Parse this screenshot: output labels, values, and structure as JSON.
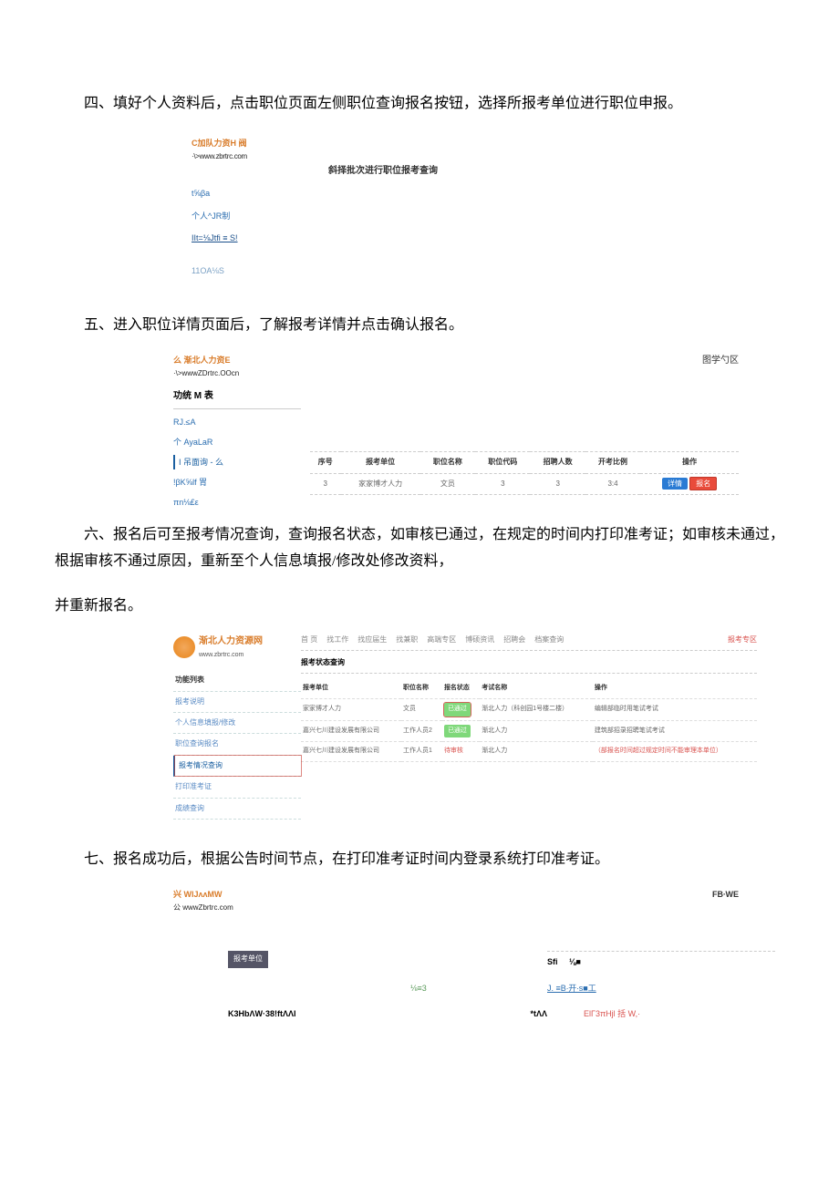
{
  "section4": {
    "instruction": "四、填好个人资料后，点击职位页面左侧职位查询报名按钮，选择所报考单位进行职位申报。",
    "logo": {
      "line1": "C加队力资H 阀",
      "line2": "·\\>www.zbrtrc.com"
    },
    "menu": {
      "item1": "t⅝βa",
      "item2": "个人^JR制",
      "item3": "IIt=⅛Jtfi ≡ S!",
      "item4": "11OA⅛S"
    },
    "main_title": "斜择批次进行职位报考查询"
  },
  "section5": {
    "instruction": "五、进入职位详情页面后，了解报考详情并点击确认报名。",
    "logo": {
      "line1": "么  渐北人力资E",
      "line2": "·\\>wwwZDrtrc.OOcn"
    },
    "sidebar_title": "功统 M 表",
    "menu": {
      "item1": "RJ.≤A",
      "item2": "个 AyaLaR",
      "item3": "I 吊面询 - 么",
      "item4": "!βK⅝lf 胃",
      "item5": "πn⅛£ε"
    },
    "right_top": "图学勺区",
    "table": {
      "headers": [
        "序号",
        "报考单位",
        "职位名称",
        "职位代码",
        "招聘人数",
        "开考比例",
        "操作"
      ],
      "row": [
        "3",
        "家家博才人力",
        "文员",
        "3",
        "3",
        "3:4"
      ],
      "btn_detail": "详情",
      "btn_apply": "报名"
    }
  },
  "section6": {
    "instruction_p1": "六、报名后可至报考情况查询，查询报名状态，如审核已通过，在规定的时间内打印准考证；如审核未通过，根据审核不通过原因，重新至个人信息填报/修改处修改资料，",
    "instruction_p2": "并重新报名。",
    "logo": {
      "line1": "渐北人力资源网",
      "line2": "www.zbrtrc.com"
    },
    "menu_title": "功能列表",
    "menu": {
      "item1": "报考说明",
      "item2": "个人信息填报/修改",
      "item3": "职位查询报名",
      "item4": "报考情况查询",
      "item5": "打印准考证",
      "item6": "成绩查询"
    },
    "tabs": [
      "首 页",
      "找工作",
      "找应届生",
      "找兼职",
      "高端专区",
      "博硕资讯",
      "招聘会",
      "档案查询",
      "报考专区"
    ],
    "subtitle": "报考状态查询",
    "headers": [
      "报考单位",
      "职位名称",
      "报名状态",
      "考试名称",
      "操作"
    ],
    "rows": [
      {
        "c1": "家家博才人力",
        "c2": "文员",
        "status_label": "已通过",
        "status_type": "green_boxed",
        "c4": "渐北人力（科创园1号楼二楼）",
        "c5": "编辑部临时用笔试考试"
      },
      {
        "c1": "嘉兴七川建设发展有限公司",
        "c2": "工作人员2",
        "status_label": "已通过",
        "status_type": "green",
        "c4": "渐北人力",
        "c5": "建筑部招录招聘笔试考试"
      },
      {
        "c1": "嘉兴七川建设发展有限公司",
        "c2": "工作人员1",
        "status_label": "待审核",
        "status_type": "red",
        "c4": "渐北人力",
        "c5": "（部报名时间超过规定时间不能审理本单位）"
      }
    ]
  },
  "section7": {
    "instruction": "七、报名成功后，根据公告时间节点，在打印准考证时间内登录系统打印准考证。",
    "logo": {
      "line1": "兴 WlJʌʌMW",
      "line2": "公 wwwZbrtrc.com"
    },
    "right": "FB∙WE",
    "grid": {
      "c1_label": "报考单位",
      "c2_sr": "Sfi",
      "c2_black": "⅛■",
      "c3_link": "J. ≡B∙开∙s■工",
      "c3_green": "⅛≡3",
      "c4_red": "ElΓ3πHjl 括 W,·",
      "c5_bold": "K3HbΛW·38!ftΛΛI",
      "c5_r": "*tΛΛ"
    }
  }
}
